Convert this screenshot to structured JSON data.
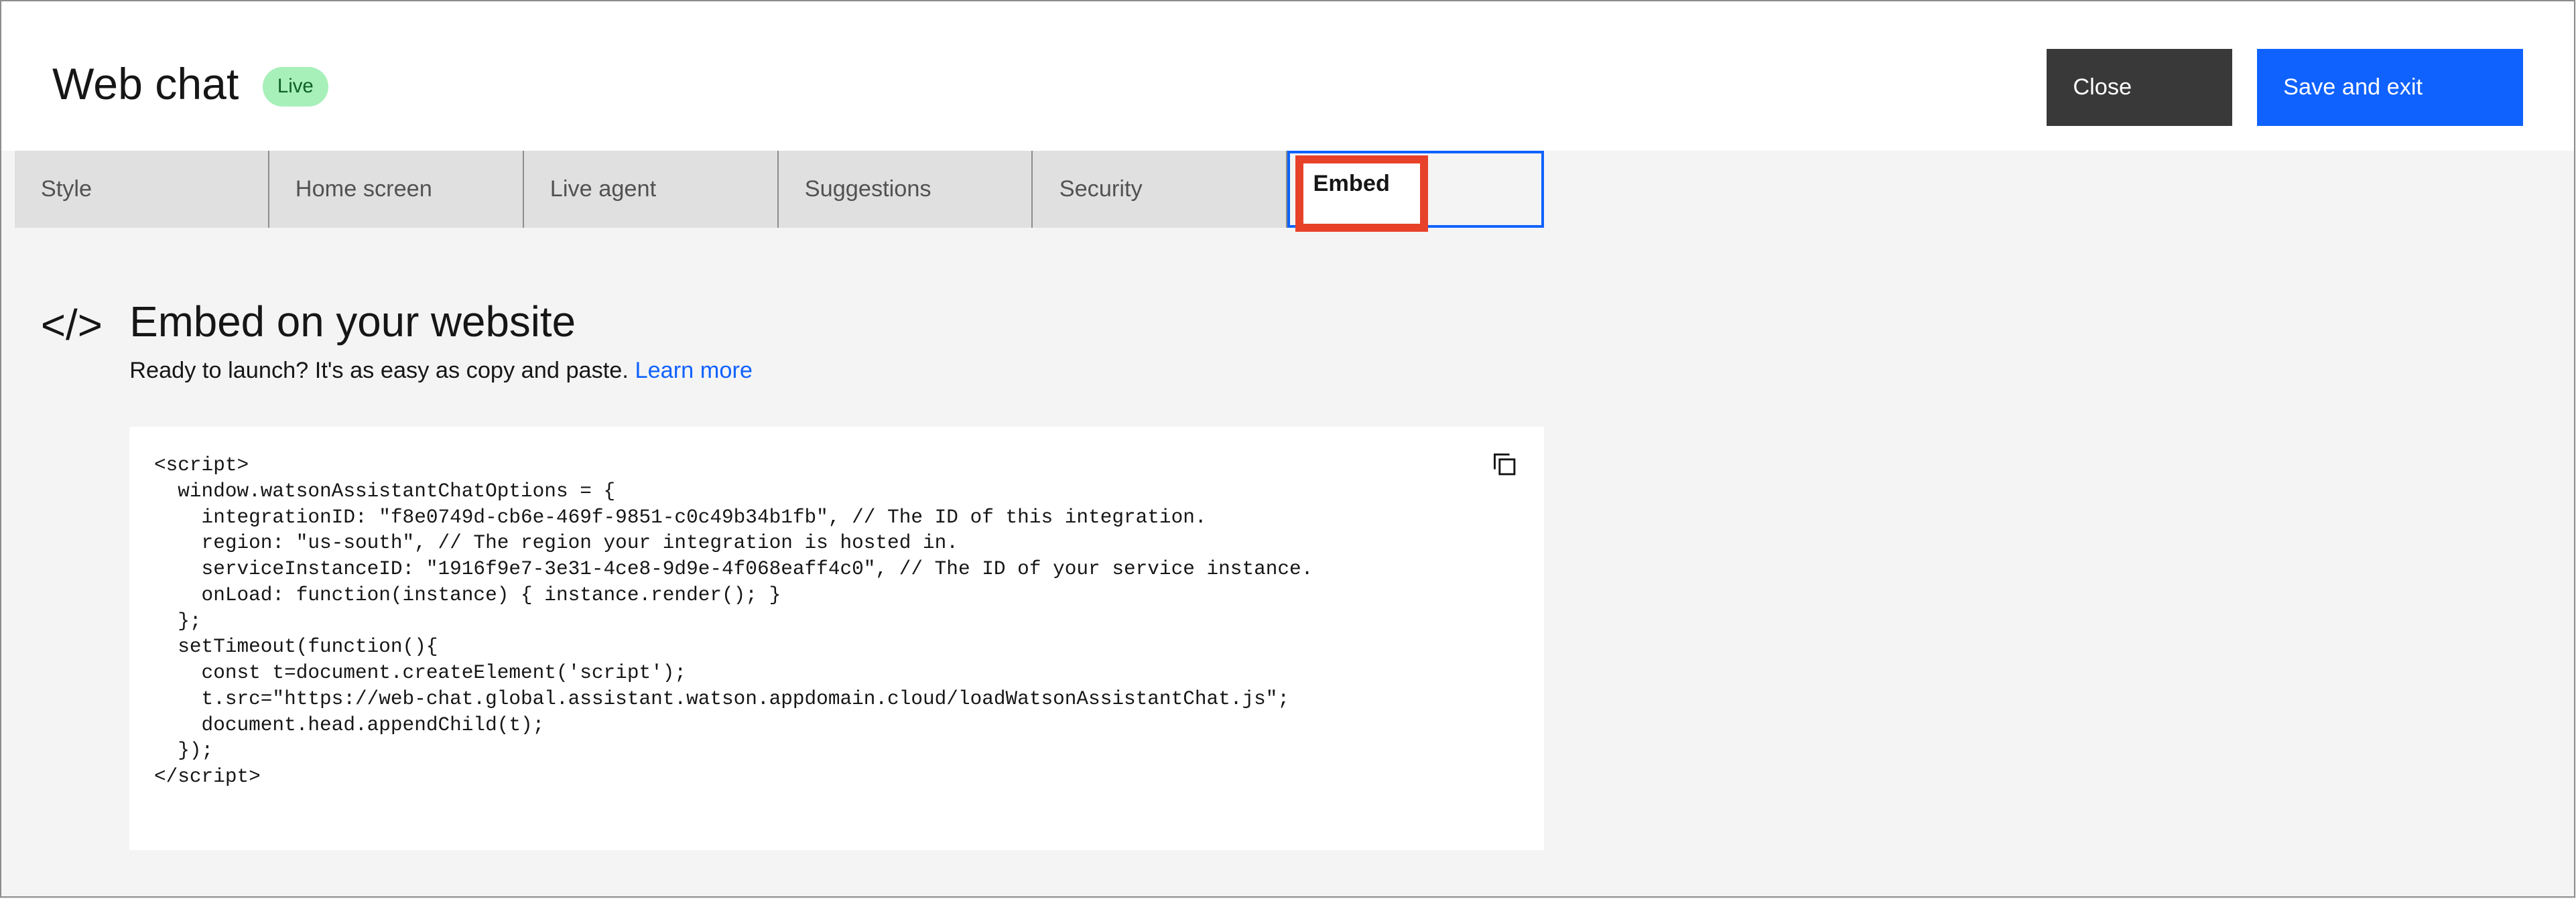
{
  "header": {
    "title": "Web chat",
    "status_badge": "Live",
    "close_label": "Close",
    "save_label": "Save and exit"
  },
  "tabs": [
    {
      "label": "Style"
    },
    {
      "label": "Home screen"
    },
    {
      "label": "Live agent"
    },
    {
      "label": "Suggestions"
    },
    {
      "label": "Security"
    },
    {
      "label": "Embed",
      "active": true
    }
  ],
  "section": {
    "icon": "code-icon",
    "heading": "Embed on your website",
    "subtitle": "Ready to launch? It's as easy as copy and paste.",
    "learn_more": "Learn more"
  },
  "code": {
    "icon": "copy-icon",
    "text": "<script>\n  window.watsonAssistantChatOptions = {\n    integrationID: \"f8e0749d-cb6e-469f-9851-c0c49b34b1fb\", // The ID of this integration.\n    region: \"us-south\", // The region your integration is hosted in.\n    serviceInstanceID: \"1916f9e7-3e31-4ce8-9d9e-4f068eaff4c0\", // The ID of your service instance.\n    onLoad: function(instance) { instance.render(); }\n  };\n  setTimeout(function(){\n    const t=document.createElement('script');\n    t.src=\"https://web-chat.global.assistant.watson.appdomain.cloud/loadWatsonAssistantChat.js\";\n    document.head.appendChild(t);\n  });\n</script>"
  },
  "colors": {
    "primary": "#0f62fe",
    "highlight": "#e8412a",
    "badge": "#a7f0ba"
  }
}
